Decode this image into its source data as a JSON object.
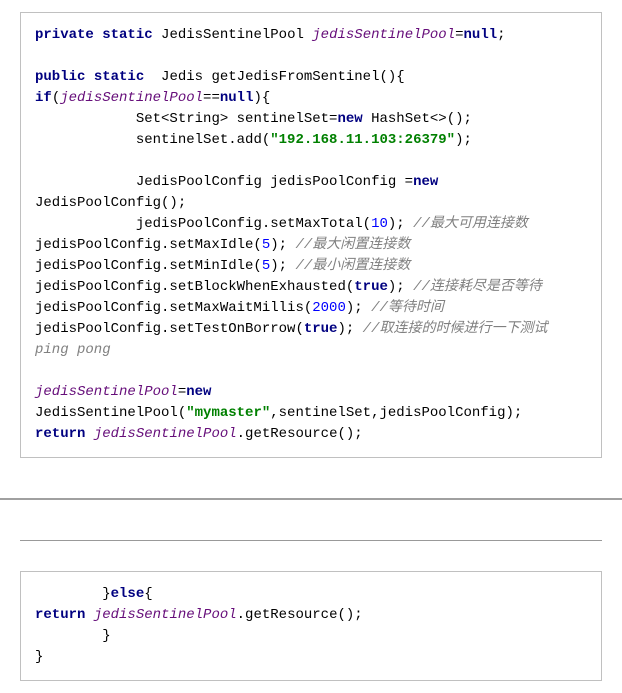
{
  "colors": {
    "keyword": "#000080",
    "identifier": "#660e7a",
    "string": "#008000",
    "number": "#0000ff",
    "comment": "#808080"
  },
  "box1": {
    "l1_kw_private": "private",
    "l1_kw_static": "static",
    "l1_type": "JedisSentinelPool ",
    "l1_ident": "jedisSentinelPool",
    "l1_eq": "=",
    "l1_null": "null",
    "l1_semi": ";",
    "l2_kw_public": "public",
    "l2_kw_static": "static",
    "l2_ret": "  Jedis getJedisFromSentinel(){",
    "l3_if": "if",
    "l3_open": "(",
    "l3_ident": "jedisSentinelPool",
    "l3_eqeq": "==",
    "l3_null": "null",
    "l3_close": "){",
    "l4_pre": "            Set<String> sentinelSet=",
    "l4_new": "new",
    "l4_post": " HashSet<>();",
    "l5_pre": "            sentinelSet.add(",
    "l5_str": "\"192.168.11.103:26379\"",
    "l5_post": ");",
    "l6_pre": "            JedisPoolConfig jedisPoolConfig =",
    "l6_new": "new",
    "l6_post": " JedisPoolConfig();",
    "l7_pre": "            jedisPoolConfig.setMaxTotal(",
    "l7_num": "10",
    "l7_post": "); ",
    "l7_comment": "//最大可用连接数",
    "l8_pre": "jedisPoolConfig.setMaxIdle(",
    "l8_num": "5",
    "l8_post": "); ",
    "l8_comment": "//最大闲置连接数",
    "l9_pre": "jedisPoolConfig.setMinIdle(",
    "l9_num": "5",
    "l9_post": "); ",
    "l9_comment": "//最小闲置连接数",
    "l10_pre": "jedisPoolConfig.setBlockWhenExhausted(",
    "l10_true": "true",
    "l10_post": "); ",
    "l10_comment": "//连接耗尽是否等待",
    "l11_pre": "jedisPoolConfig.setMaxWaitMillis(",
    "l11_num": "2000",
    "l11_post": "); ",
    "l11_comment": "//等待时间",
    "l12_pre": "jedisPoolConfig.setTestOnBorrow(",
    "l12_true": "true",
    "l12_post": "); ",
    "l12_comment": "//取连接的时候进行一下测试 ping pong",
    "l13_ident": "jedisSentinelPool",
    "l13_eq": "=",
    "l13_new": "new",
    "l14_pre": "JedisSentinelPool(",
    "l14_str": "\"mymaster\"",
    "l14_post": ",sentinelSet,jedisPoolConfig);",
    "l15_kw_return": "return",
    "l15_sp": " ",
    "l15_ident": "jedisSentinelPool",
    "l15_post": ".getResource();"
  },
  "box2": {
    "l1_pre": "        }",
    "l1_else": "else",
    "l1_post": "{",
    "l2_kw_return": "return",
    "l2_sp": " ",
    "l2_ident": "jedisSentinelPool",
    "l2_post": ".getResource();",
    "l3": "        }",
    "l4": "}"
  }
}
